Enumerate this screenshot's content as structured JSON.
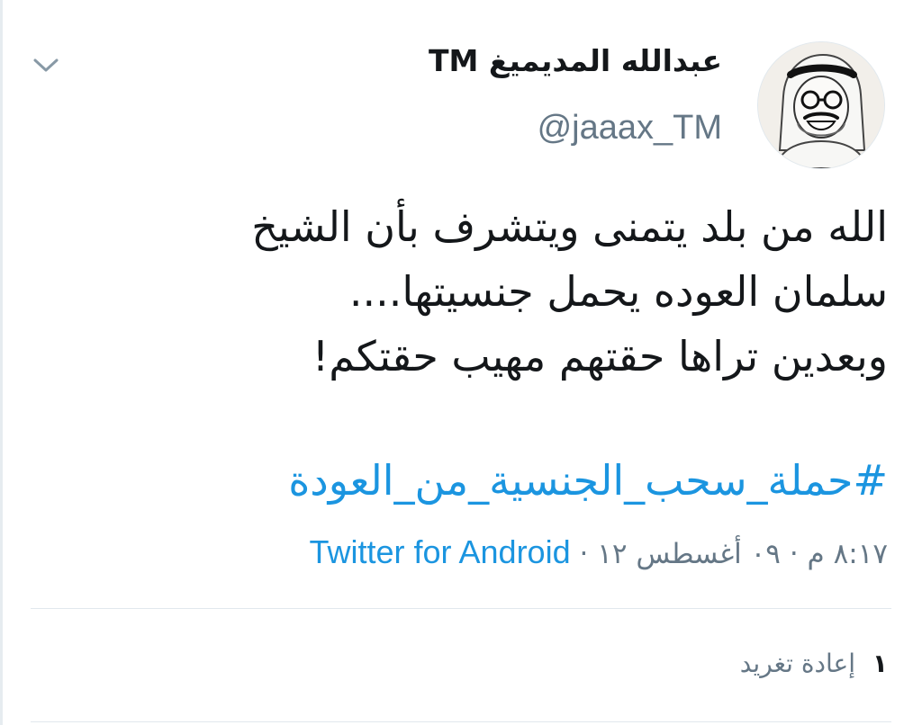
{
  "tweet": {
    "author": {
      "display_name": "عبدالله المديميغ TM",
      "handle": "@jaaax_TM"
    },
    "text_lines": [
      "الله من بلد يتمنى ويتشرف بأن الشيخ",
      "سلمان العوده يحمل جنسيتها....",
      "وبعدين تراها حقتهم مهيب حقتكم!"
    ],
    "hashtag": "#حملة_سحب_الجنسية_من_العودة",
    "meta": {
      "time": "٨:١٧ م",
      "date": "٠٩ أغسطس ١٢",
      "separator": "·",
      "source": "Twitter for Android"
    },
    "stats": {
      "retweet_count": "١",
      "retweet_label": "إعادة تغريد"
    }
  },
  "icons": {
    "menu": "chevron-down-icon",
    "avatar": "avatar-image"
  },
  "colors": {
    "link": "#1b95e0",
    "text": "#14171a",
    "muted": "#657786",
    "divider": "#e1e8ed"
  }
}
